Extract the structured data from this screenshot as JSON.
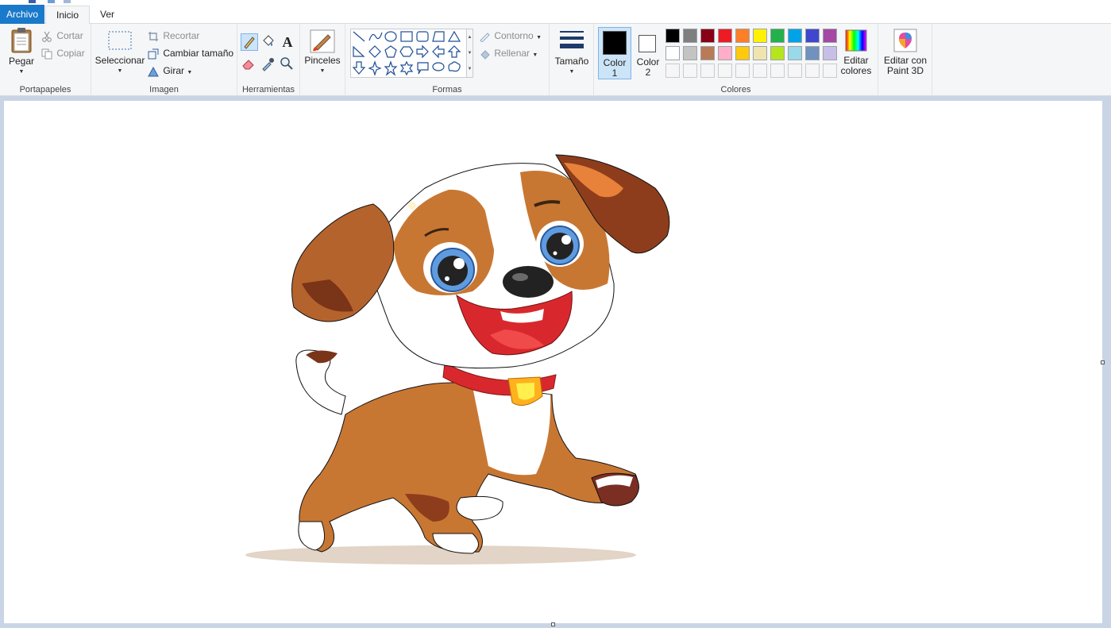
{
  "tabs": {
    "archivo": "Archivo",
    "inicio": "Inicio",
    "ver": "Ver"
  },
  "clipboard": {
    "paste": "Pegar",
    "cut": "Cortar",
    "copy": "Copiar",
    "label": "Portapapeles"
  },
  "image": {
    "select": "Seleccionar",
    "crop": "Recortar",
    "resize": "Cambiar tamaño",
    "rotate": "Girar",
    "label": "Imagen"
  },
  "tools": {
    "label": "Herramientas",
    "text_glyph": "A"
  },
  "brushes": {
    "label": "Pinceles"
  },
  "shapes": {
    "label": "Formas",
    "outline": "Contorno",
    "fill": "Rellenar"
  },
  "size": {
    "label": "Tamaño"
  },
  "colors": {
    "color1_label": "Color 1",
    "color1_line1": "Color",
    "color1_line2": "1",
    "color2_line1": "Color",
    "color2_line2": "2",
    "edit_line1": "Editar",
    "edit_line2": "colores",
    "label": "Colores",
    "color1_value": "#000000",
    "color2_value": "#ffffff",
    "palette_row1": [
      "#000000",
      "#7f7f7f",
      "#880015",
      "#ed1c24",
      "#ff7f27",
      "#fff200",
      "#22b14c",
      "#00a2e8",
      "#3f48cc",
      "#a349a4"
    ],
    "palette_row2": [
      "#ffffff",
      "#c3c3c3",
      "#b97a57",
      "#ffaec9",
      "#ffc90e",
      "#efe4b0",
      "#b5e61d",
      "#99d9ea",
      "#7092be",
      "#c8bfe7"
    ]
  },
  "paint3d": {
    "line1": "Editar con",
    "line2": "Paint 3D"
  },
  "accent": "#1979ca"
}
